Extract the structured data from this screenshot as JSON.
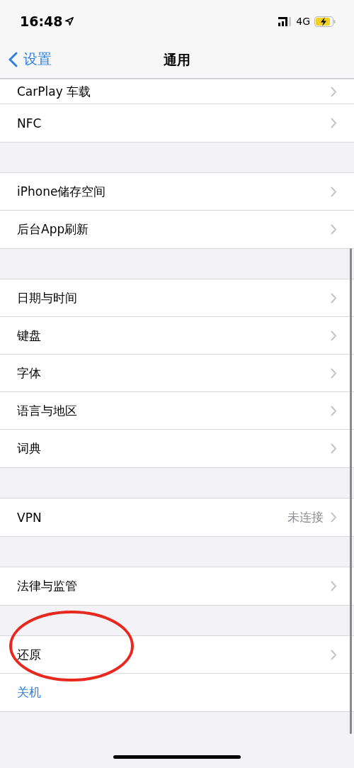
{
  "status_bar": {
    "time": "16:48",
    "network": "4G",
    "charging": true
  },
  "nav": {
    "back": "设置",
    "title": "通用"
  },
  "groups": [
    {
      "items": [
        {
          "kind": "link",
          "label": "CarPlay 车载",
          "partial": true
        },
        {
          "kind": "link",
          "label": "NFC"
        }
      ]
    },
    {
      "items": [
        {
          "kind": "link",
          "label": "iPhone储存空间"
        },
        {
          "kind": "link",
          "label": "后台App刷新"
        }
      ]
    },
    {
      "items": [
        {
          "kind": "link",
          "label": "日期与时间"
        },
        {
          "kind": "link",
          "label": "键盘"
        },
        {
          "kind": "link",
          "label": "字体"
        },
        {
          "kind": "link",
          "label": "语言与地区"
        },
        {
          "kind": "link",
          "label": "词典"
        }
      ]
    },
    {
      "items": [
        {
          "kind": "link",
          "label": "VPN",
          "value": "未连接"
        }
      ]
    },
    {
      "items": [
        {
          "kind": "link",
          "label": "法律与监管"
        }
      ]
    },
    {
      "items": [
        {
          "kind": "link",
          "label": "还原",
          "circled": true
        },
        {
          "kind": "action",
          "label": "关机"
        }
      ]
    }
  ]
}
